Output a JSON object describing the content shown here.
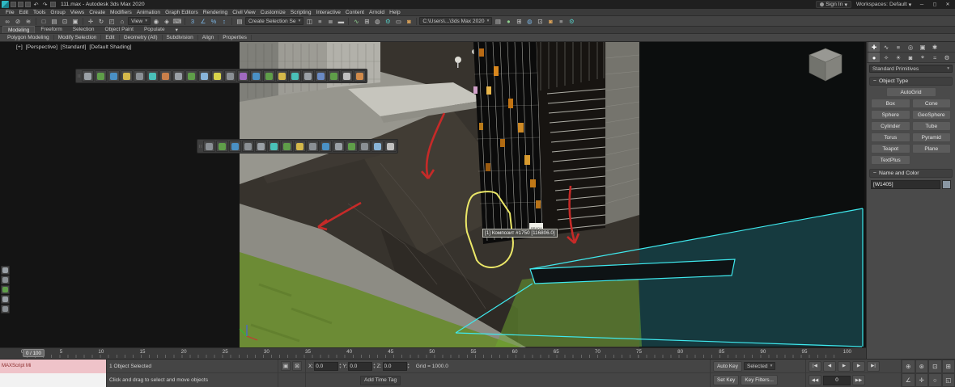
{
  "titlebar": {
    "title": "111.max - Autodesk 3ds Max 2020",
    "sign_in": "Sign In",
    "workspaces_label": "Workspaces:",
    "workspaces_value": "Default"
  },
  "menubar": {
    "items": [
      "File",
      "Edit",
      "Tools",
      "Group",
      "Views",
      "Create",
      "Modifiers",
      "Animation",
      "Graph Editors",
      "Rendering",
      "Civil View",
      "Customize",
      "Scripting",
      "Interactive",
      "Content",
      "Arnold",
      "Help"
    ]
  },
  "toolbar": {
    "view_ref": "View",
    "selection_set": "Create Selection Se",
    "project_path": "C:\\Users\\...\\3ds Max 2020"
  },
  "ribbon": {
    "tabs": [
      "Modeling",
      "Freeform",
      "Selection",
      "Object Paint",
      "Populate"
    ],
    "sections": [
      "Polygon Modeling",
      "Modify Selection",
      "Edit",
      "Geometry (All)",
      "Subdivision",
      "Align",
      "Properties"
    ]
  },
  "viewport": {
    "general": "[+]",
    "pov": "[Perspective]",
    "standard": "[Standard]",
    "shading": "[Default Shading]",
    "tooltip": "[1] Композит #1750 [116806.0]",
    "sign": "PRADA"
  },
  "command_panel": {
    "primitive_dropdown": "Standard Primitives",
    "object_type": "Object Type",
    "autogrid": "AutoGrid",
    "buttons": [
      "Box",
      "Cone",
      "Sphere",
      "GeoSphere",
      "Cylinder",
      "Tube",
      "Torus",
      "Pyramid",
      "Teapot",
      "Plane",
      "TextPlus"
    ],
    "name_and_color": "Name and Color",
    "object_name": "[W1405]"
  },
  "timeline": {
    "slider": "0 / 100",
    "ticks": [
      "0",
      "5",
      "10",
      "15",
      "20",
      "25",
      "30",
      "35",
      "40",
      "45",
      "50",
      "55",
      "60",
      "65",
      "70",
      "75",
      "80",
      "85",
      "90",
      "95",
      "100"
    ]
  },
  "statusbar": {
    "maxscript": "MAXScript Mi",
    "selection_status": "1 Object Selected",
    "prompt": "Click and drag to select and move objects",
    "x": "X:",
    "y": "Y:",
    "z": "Z:",
    "xval": "0.0",
    "yval": "0.0",
    "zval": "0.0",
    "grid": "Grid = 1000.0",
    "add_time_tag": "Add Time Tag",
    "auto_key": "Auto Key",
    "set_key": "Set Key",
    "selected": "Selected",
    "key_filters": "Key Filters...",
    "frame": "0"
  },
  "icons": {
    "minimize": "─",
    "maximize": "◻",
    "close": "✕",
    "dropdown": "▾",
    "undo": "↶",
    "redo": "↷",
    "link": "∞",
    "unlink": "⊘",
    "bind": "≋",
    "select": "□",
    "select_by_name": "▤",
    "region": "⊡",
    "window_crossing": "▣",
    "move": "✛",
    "rotate": "↻",
    "scale": "◰",
    "place": "⌂",
    "pivot": "◉",
    "manipulate": "◈",
    "kbd": "⌨",
    "snap": "3",
    "snap_angle": "∠",
    "snap_percent": "%",
    "snap_spinner": "↕",
    "named_sets": "▤",
    "mirror": "◫",
    "align": "≡",
    "layer": "≣",
    "ribbon": "▬",
    "curve": "∿",
    "schematic": "⊞",
    "material": "◍",
    "render_setup": "⚙",
    "rendered_frame": "▭",
    "render": "◙",
    "rollout": "−",
    "cp_create": "✚",
    "cp_modify": "∿",
    "cp_hierarchy": "≡",
    "cp_motion": "◎",
    "cp_display": "▣",
    "cp_utilities": "✱",
    "cat_geometry": "●",
    "cat_shapes": "✧",
    "cat_lights": "☀",
    "cat_cameras": "◙",
    "cat_helpers": "⌖",
    "cat_warps": "≈",
    "cat_systems": "⚙",
    "isolate": "▣",
    "lock": "⊠",
    "spin_up": "▴",
    "spin_down": "▾",
    "goto_start": "|◀",
    "prev_frame": "◀",
    "play": "▶",
    "next_frame": "▶",
    "goto_end": "▶|",
    "prev_key": "◀◀",
    "next_key": "▶▶",
    "nav_zoom": "⊕",
    "nav_zoom_all": "⊛",
    "nav_extents": "⊡",
    "nav_region": "⊞",
    "nav_fov": "∠",
    "nav_pan": "✛",
    "nav_orbit": "○",
    "nav_max": "◱",
    "handle": "∷"
  }
}
